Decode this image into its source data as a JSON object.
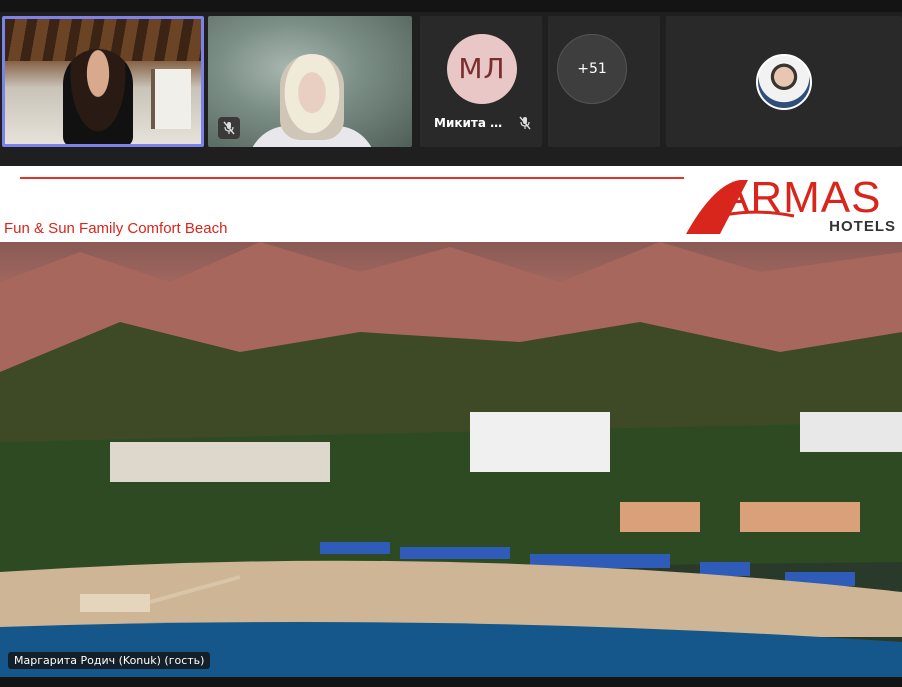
{
  "participants": {
    "tile_1": {
      "highlight_color": "#7b83eb"
    },
    "tile_2": {
      "muted": true
    },
    "tile_3": {
      "initials": "МЛ",
      "name": "Микита Ан...",
      "muted": true
    },
    "tile_4": {
      "overflow_label": "+51"
    },
    "tile_5": {}
  },
  "slide": {
    "title": "Fun & Sun Family Comfort Beach",
    "logo_main": "ARMAS",
    "logo_sub": "HOTELS",
    "brand_color": "#d8261c"
  },
  "presenter_caption": "Маргарита Родич (Konuk) (гость)",
  "icons": {
    "mic_off": "mic-off-icon"
  }
}
